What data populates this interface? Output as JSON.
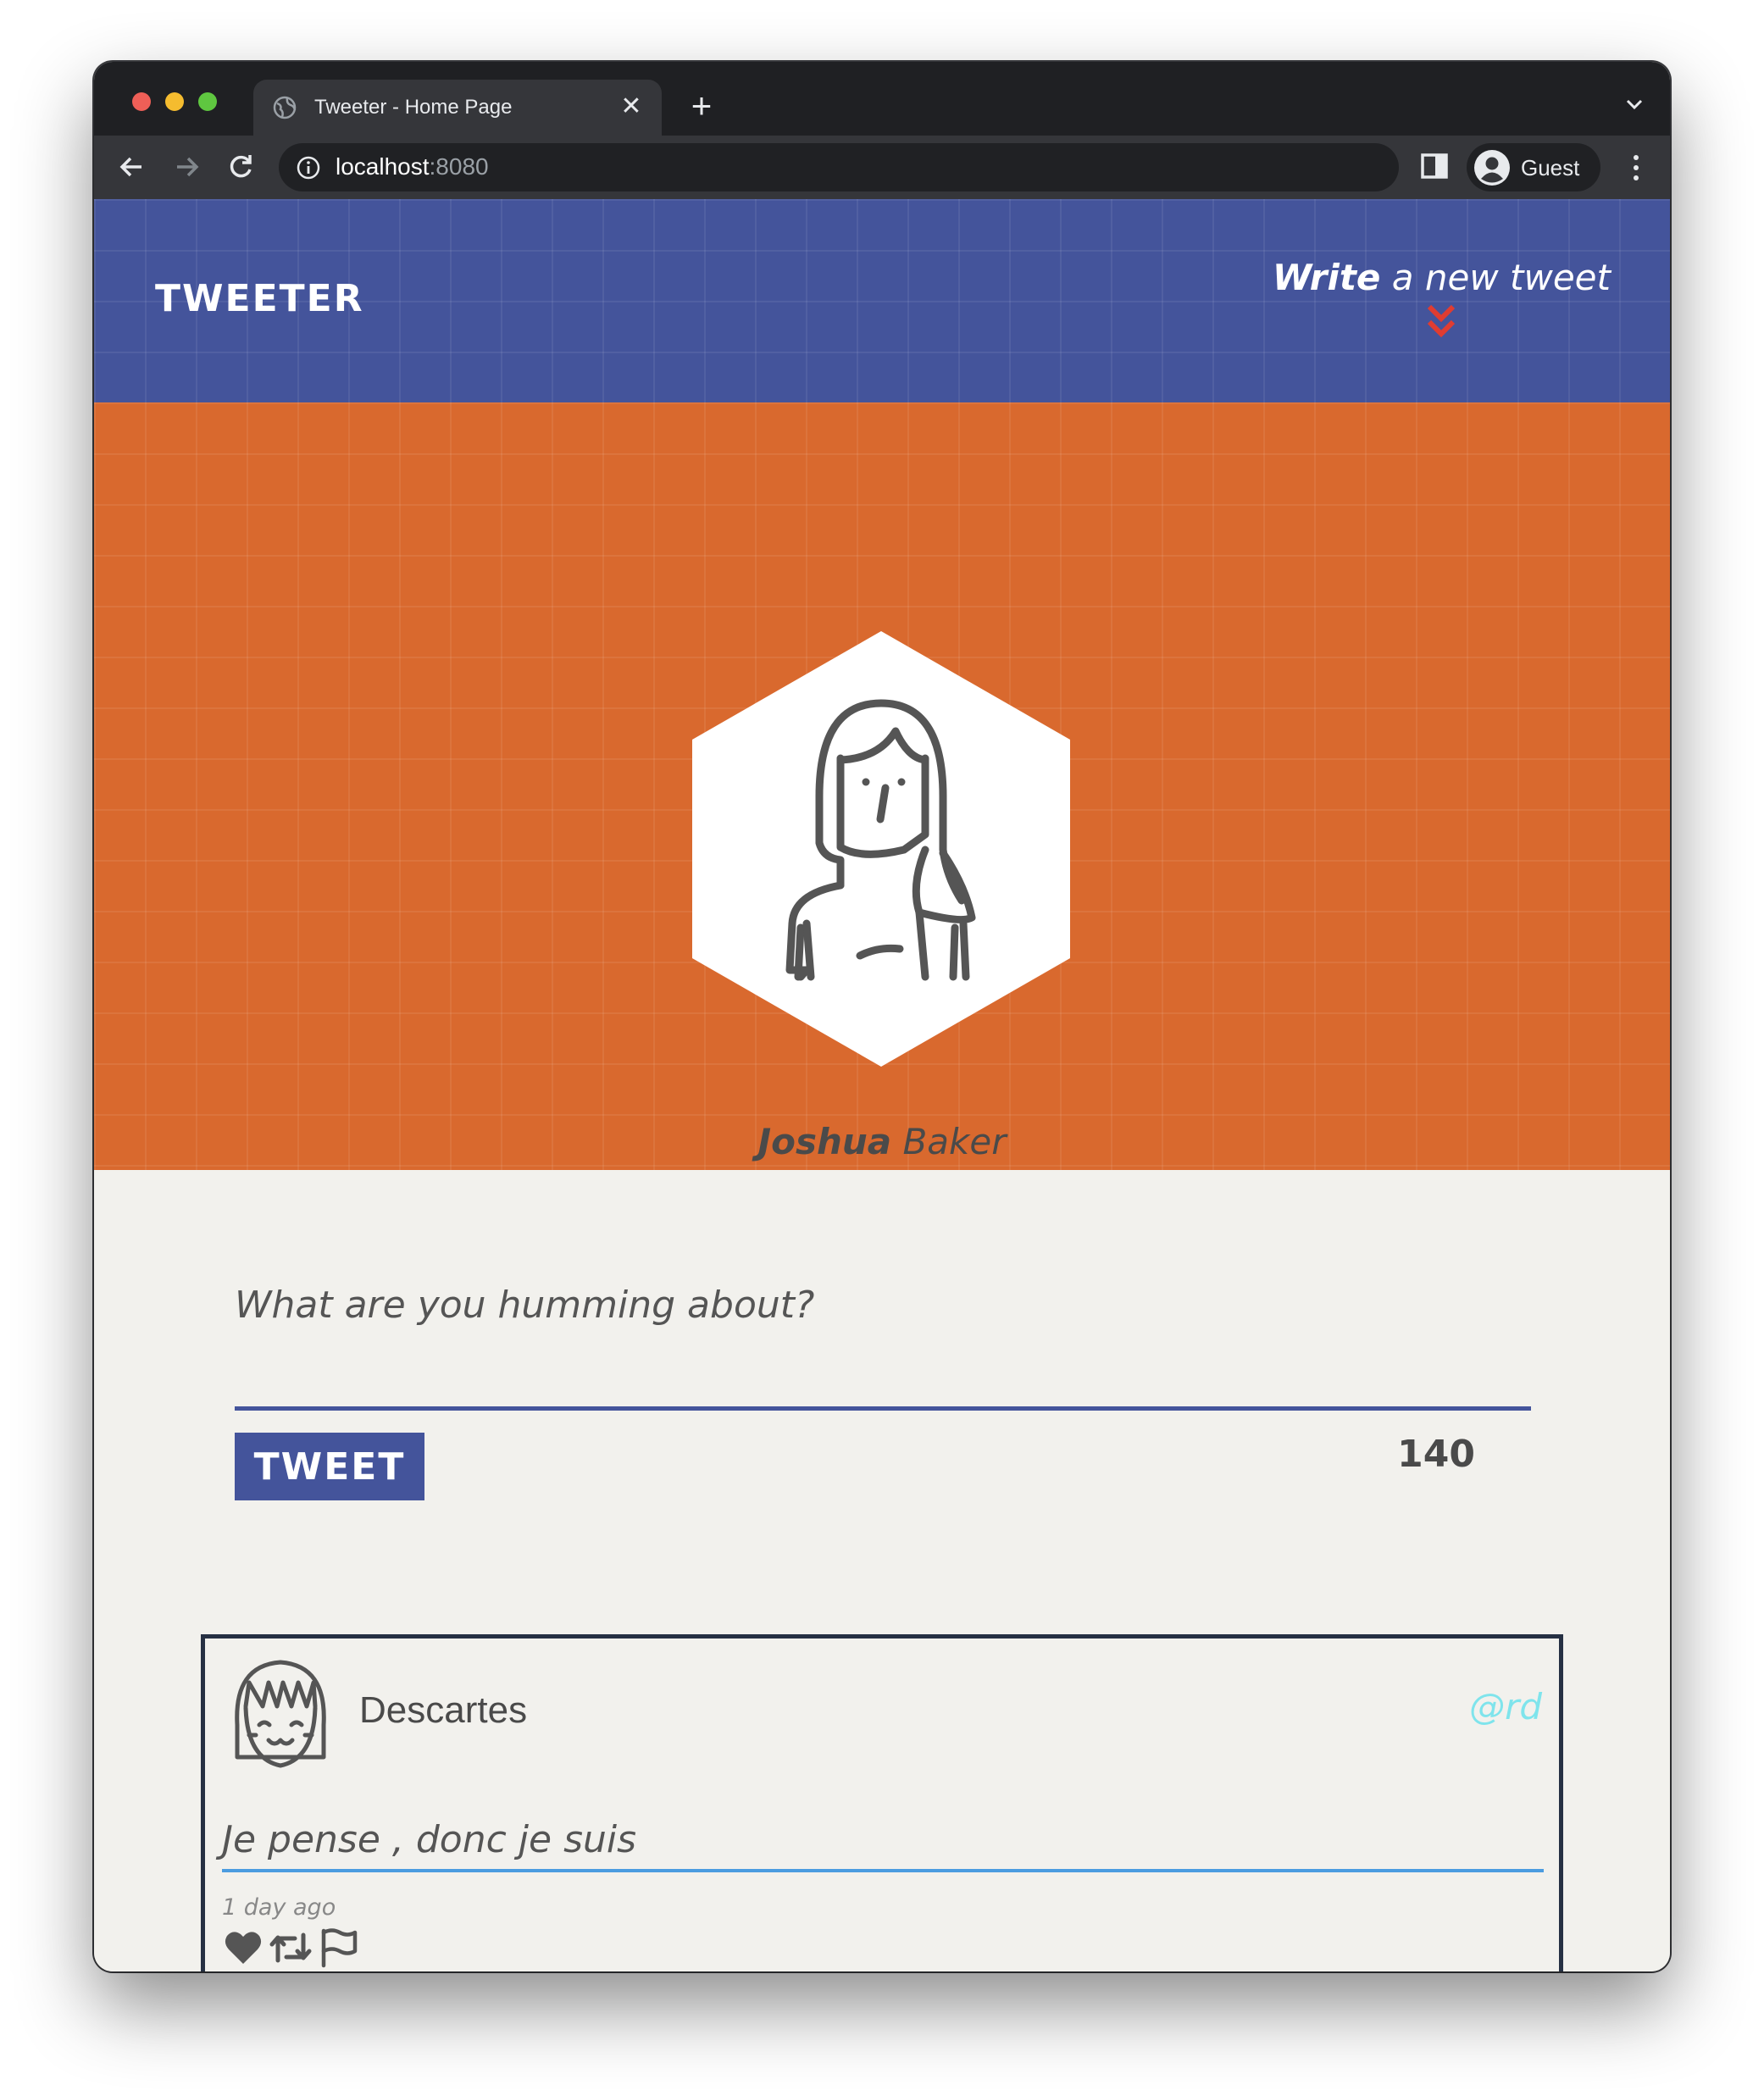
{
  "browser": {
    "tab_title": "Tweeter - Home Page",
    "tab_close": "✕",
    "new_tab": "+",
    "url_host": "localhost",
    "url_port": ":8080",
    "profile_label": "Guest"
  },
  "navbar": {
    "brand": "TWEETER",
    "compose_strong": "Write",
    "compose_rest": " a new tweet"
  },
  "profile": {
    "first_name": "Joshua",
    "last_name": " Baker"
  },
  "compose": {
    "placeholder": "What are you humming about?",
    "button_label": "TWEET",
    "counter": "140"
  },
  "tweets": [
    {
      "author": "Descartes",
      "handle": "@rd",
      "text": "Je pense , donc je suis",
      "time": "1 day ago"
    }
  ],
  "icons": {
    "compose_chevron": "double-chevron-down-icon",
    "actions": [
      "heart-icon",
      "retweet-icon",
      "flag-icon"
    ]
  },
  "colors": {
    "navbar": "#44549b",
    "banner": "#d9692e",
    "page_bg": "#f2f1ed",
    "chevron": "#e03c31",
    "handle": "#7fe4ec",
    "tweet_border": "#263043",
    "tweet_underline": "#4b9ce0"
  }
}
